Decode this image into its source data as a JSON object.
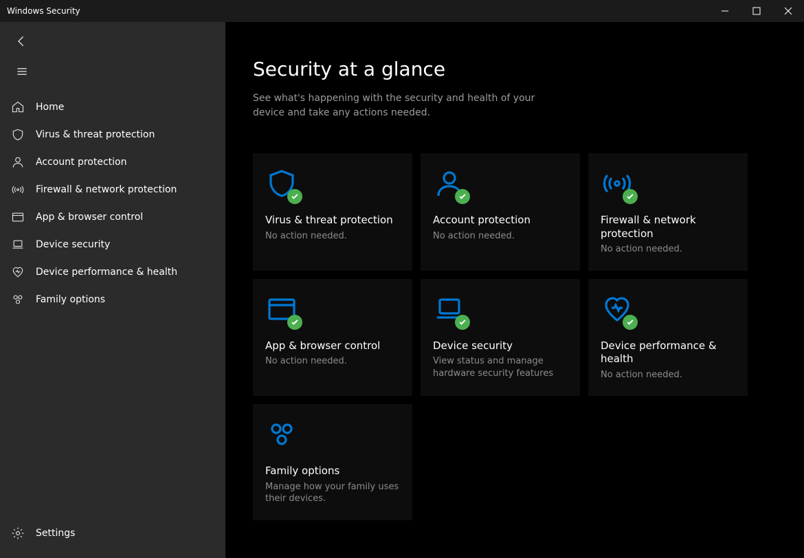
{
  "window": {
    "title": "Windows Security"
  },
  "sidebar": {
    "items": [
      {
        "label": "Home",
        "icon": "home"
      },
      {
        "label": "Virus & threat protection",
        "icon": "shield"
      },
      {
        "label": "Account protection",
        "icon": "person"
      },
      {
        "label": "Firewall & network protection",
        "icon": "antenna"
      },
      {
        "label": "App & browser control",
        "icon": "browser"
      },
      {
        "label": "Device security",
        "icon": "laptop"
      },
      {
        "label": "Device performance & health",
        "icon": "heart"
      },
      {
        "label": "Family options",
        "icon": "family"
      }
    ],
    "settings_label": "Settings"
  },
  "main": {
    "heading": "Security at a glance",
    "subtitle": "See what's happening with the security and health of your device and take any actions needed.",
    "tiles": [
      {
        "title": "Virus & threat protection",
        "subtitle": "No action needed.",
        "icon": "shield",
        "badge": "ok"
      },
      {
        "title": "Account protection",
        "subtitle": "No action needed.",
        "icon": "person",
        "badge": "ok"
      },
      {
        "title": "Firewall & network protection",
        "subtitle": "No action needed.",
        "icon": "antenna",
        "badge": "ok"
      },
      {
        "title": "App & browser control",
        "subtitle": "No action needed.",
        "icon": "browser",
        "badge": "ok"
      },
      {
        "title": "Device security",
        "subtitle": "View status and manage hardware security features",
        "icon": "laptop",
        "badge": "ok"
      },
      {
        "title": "Device performance & health",
        "subtitle": "No action needed.",
        "icon": "heart",
        "badge": "ok"
      },
      {
        "title": "Family options",
        "subtitle": "Manage how your family uses their devices.",
        "icon": "family",
        "badge": "none"
      }
    ]
  },
  "colors": {
    "accent": "#0078d4",
    "ok_badge": "#4CAF50"
  }
}
